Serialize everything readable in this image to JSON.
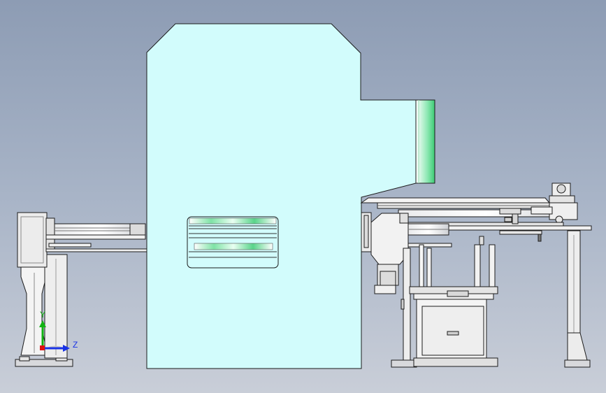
{
  "triad": {
    "y_label": "Y",
    "z_label": "Z",
    "y_color": "#12b312",
    "z_color": "#1a33e6",
    "x_color": "#e01010"
  },
  "colors": {
    "press_fill": "#d2fcfc",
    "outline": "#1c1c1c",
    "metal_light": "#f2f2f2",
    "metal_mid": "#d4d6da",
    "accent_green": "#4fd17e"
  }
}
